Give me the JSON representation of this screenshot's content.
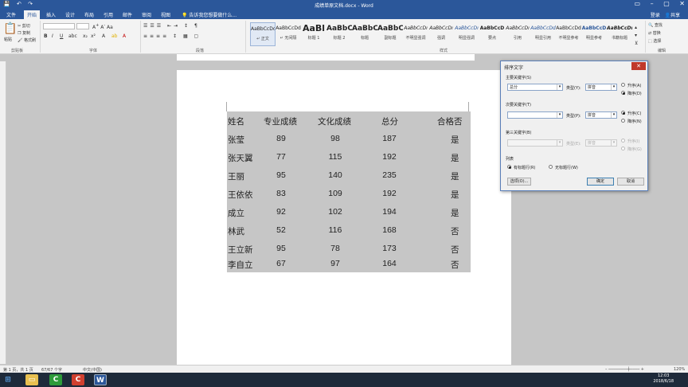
{
  "window": {
    "title": "成绩单原文档.docx - Word",
    "quick_access": [
      "💾",
      "↶",
      "↷"
    ],
    "win_controls": [
      "▭",
      "–",
      "▢",
      "✕"
    ]
  },
  "tabs": [
    "文件",
    "开始",
    "插入",
    "设计",
    "布局",
    "引用",
    "邮件",
    "审阅",
    "视图"
  ],
  "tell_me": "告诉我您想要做什么...",
  "account": {
    "login": "登录",
    "share": "共享"
  },
  "ribbon": {
    "clipboard": {
      "paste": "粘贴",
      "cut": "剪切",
      "copy": "复制",
      "format_painter": "格式刷",
      "label": "剪贴板"
    },
    "font": {
      "name": "",
      "size": "",
      "label": "字体"
    },
    "paragraph": {
      "label": "段落"
    },
    "styles": {
      "label": "样式",
      "items": [
        {
          "preview": "AaBbCcDd",
          "name": "↵ 正文"
        },
        {
          "preview": "AaBbCcDd",
          "name": "↵ 无间隔"
        },
        {
          "preview": "AaBl",
          "name": "标题 1"
        },
        {
          "preview": "AaBbC",
          "name": "标题 2"
        },
        {
          "preview": "AaBbC",
          "name": "标题"
        },
        {
          "preview": "AaBbC",
          "name": "副标题"
        },
        {
          "preview": "AaBbCcDı",
          "name": "不明显强调"
        },
        {
          "preview": "AaBbCcDı",
          "name": "强调"
        },
        {
          "preview": "AaBbCcDı",
          "name": "明显强调"
        },
        {
          "preview": "AaBbCcD",
          "name": "要点"
        },
        {
          "preview": "AaBbCcDı",
          "name": "引用"
        },
        {
          "preview": "AaBbCcDd",
          "name": "明显引用"
        },
        {
          "preview": "AaBbCcDd",
          "name": "不明显参考"
        },
        {
          "preview": "AaBbCcD",
          "name": "明显参考"
        },
        {
          "preview": "AaBbCcDı",
          "name": "书籍标题"
        }
      ]
    },
    "editing": {
      "find": "查找",
      "replace": "替换",
      "select": "选择",
      "label": "编辑"
    }
  },
  "table": {
    "headers": [
      "姓名",
      "专业成绩",
      "文化成绩",
      "总分",
      "合格否"
    ],
    "rows": [
      [
        "张莹",
        "89",
        "98",
        "187",
        "是"
      ],
      [
        "张天翼",
        "77",
        "115",
        "192",
        "是"
      ],
      [
        "王丽",
        "95",
        "140",
        "235",
        "是"
      ],
      [
        "王依依",
        "83",
        "109",
        "192",
        "是"
      ],
      [
        "成立",
        "92",
        "102",
        "194",
        "是"
      ],
      [
        "林武",
        "52",
        "116",
        "168",
        "否"
      ],
      [
        "王立新",
        "95",
        "78",
        "173",
        "否"
      ],
      [
        "李自立",
        "67",
        "97",
        "164",
        "否"
      ]
    ]
  },
  "dialog": {
    "title": "排序文字",
    "close": "✕",
    "primary": {
      "label": "主要关键字(S)",
      "value": "总分",
      "type_label": "类型(Y):",
      "type_value": "拼音",
      "asc": "升序(A)",
      "desc": "降序(D)"
    },
    "secondary": {
      "label": "次要关键字(T)",
      "value": "",
      "type_label": "类型(P):",
      "type_value": "拼音",
      "asc": "升序(C)",
      "desc": "降序(N)"
    },
    "tertiary": {
      "label": "第三关键字(B)",
      "value": "",
      "type_label": "类型(E):",
      "type_value": "拼音",
      "asc": "升序(I)",
      "desc": "降序(G)"
    },
    "list_label": "列表",
    "has_header": "有标题行(R)",
    "no_header": "无标题行(W)",
    "options": "选项(O)...",
    "ok": "确定",
    "cancel": "取消"
  },
  "status": {
    "page": "第 1 页，共 1 页",
    "words": "67/67 个字",
    "lang": "中文(中国)",
    "zoom": "120%"
  },
  "taskbar": {
    "time": "12:03",
    "date": "2018/6/18"
  }
}
